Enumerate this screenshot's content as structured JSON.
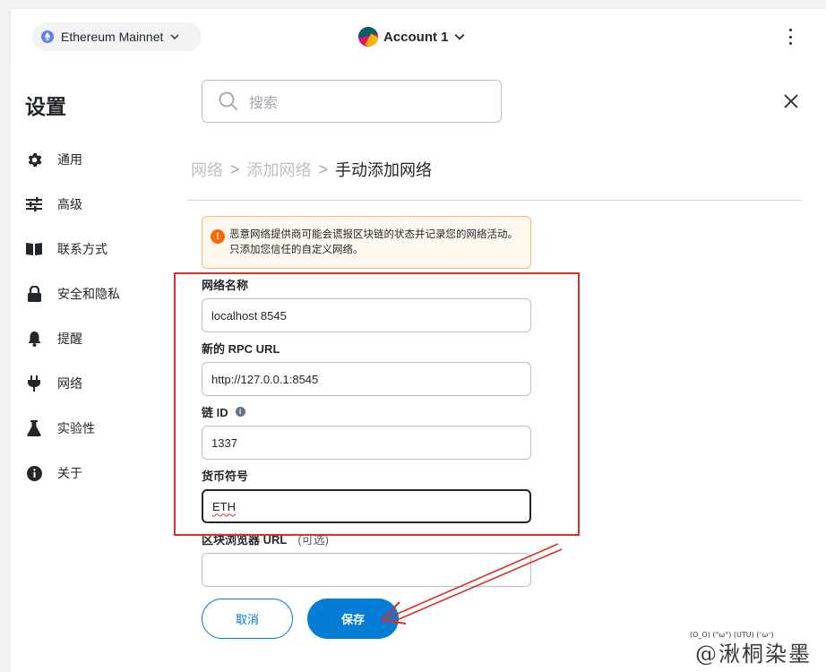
{
  "topbar": {
    "network_label": "Ethereum Mainnet",
    "account_label": "Account 1"
  },
  "sidebar": {
    "title": "设置",
    "items": [
      {
        "label": "通用",
        "icon": "gear-icon"
      },
      {
        "label": "高级",
        "icon": "sliders-icon"
      },
      {
        "label": "联系方式",
        "icon": "book-icon"
      },
      {
        "label": "安全和隐私",
        "icon": "lock-icon"
      },
      {
        "label": "提醒",
        "icon": "bell-icon"
      },
      {
        "label": "网络",
        "icon": "plug-icon"
      },
      {
        "label": "实验性",
        "icon": "flask-icon"
      },
      {
        "label": "关于",
        "icon": "info-icon"
      }
    ]
  },
  "search": {
    "placeholder": "搜索"
  },
  "breadcrumb": {
    "level1": "网络",
    "sep": ">",
    "level2": "添加网络",
    "current": "手动添加网络"
  },
  "warning": {
    "text": "恶意网络提供商可能会谎报区块链的状态并记录您的网络活动。只添加您信任的自定义网络。"
  },
  "form": {
    "network_name_label": "网络名称",
    "network_name_value": "localhost 8545",
    "rpc_url_label": "新的 RPC URL",
    "rpc_url_value": "http://127.0.0.1:8545",
    "chain_id_label": "链 ID",
    "chain_id_value": "1337",
    "currency_label": "货币符号",
    "currency_value": "ETH",
    "explorer_label": "区块浏览器 URL",
    "explorer_optional": "(可选)",
    "explorer_value": ""
  },
  "buttons": {
    "cancel": "取消",
    "save": "保存"
  },
  "watermark": {
    "faces": "(O_O) (°ω°) (UTU) (ᵔωᵔ)",
    "text": "@湫桐染墨"
  },
  "colors": {
    "accent": "#037dd6",
    "annotation_red": "#d8302a",
    "warning_orange": "#f66a0a"
  }
}
